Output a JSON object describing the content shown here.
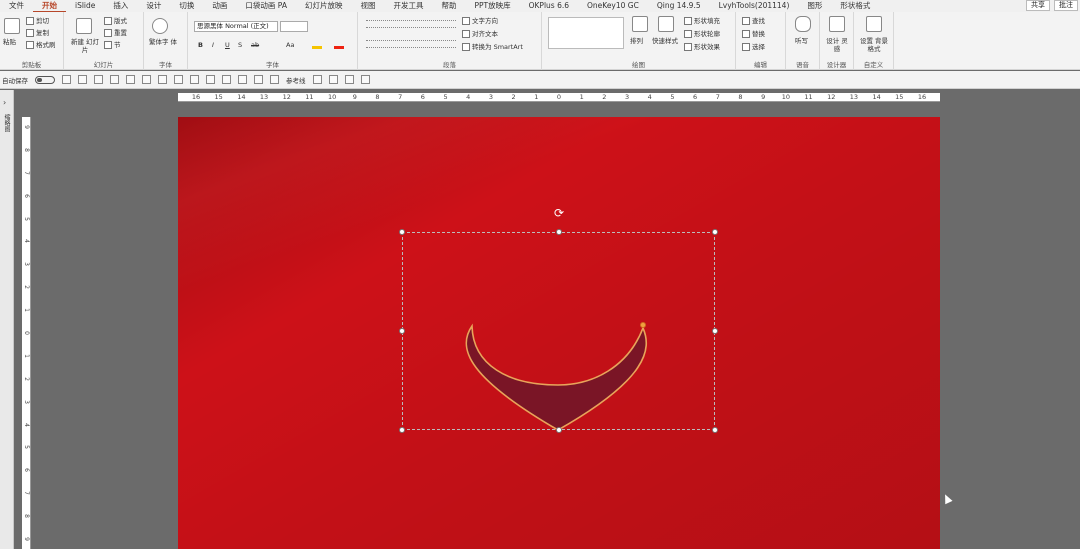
{
  "tabs": [
    "文件",
    "开始",
    "iSlide",
    "插入",
    "设计",
    "切换",
    "动画",
    "口袋动画 PA",
    "幻灯片放映",
    "视图",
    "开发工具",
    "帮助",
    "PPT放映库",
    "OKPlus 6.6",
    "OneKey10 GC",
    "Qing 14.9.5",
    "LvyhTools(201114)",
    "图形",
    "形状格式"
  ],
  "active_tab": "开始",
  "tabs_right": {
    "share": "共享",
    "comment": "批注"
  },
  "ribbon": {
    "clipboard": {
      "label": "剪贴板",
      "paste": "粘贴",
      "cut": "剪切",
      "copy": "复制",
      "format_painter": "格式刷"
    },
    "slides": {
      "label": "幻灯片",
      "new_slide": "新建 幻灯片",
      "layout": "版式",
      "reset": "重置",
      "section": "节"
    },
    "chinese": {
      "label": "字体",
      "name": "繁体字 体"
    },
    "font": {
      "label": "字体",
      "font_name": "思源黑体 Normal (正文)",
      "size": "",
      "bold": "B",
      "italic": "I",
      "underline": "U",
      "strike": "S",
      "spacing": "ab",
      "case": "Aa"
    },
    "paragraph": {
      "label": "段落",
      "text_direction": "文字方向",
      "align_text": "对齐文本",
      "smartart": "转换为 SmartArt"
    },
    "drawing": {
      "label": "绘图",
      "arrange": "排列",
      "quick_styles": "快速样式",
      "shape_fill": "形状填充",
      "shape_outline": "形状轮廓",
      "shape_effects": "形状效果"
    },
    "editing": {
      "label": "编辑",
      "find": "查找",
      "replace": "替换",
      "select": "选择"
    },
    "voice": {
      "label": "语音",
      "dictate": "听写"
    },
    "designer": {
      "label": "设计器",
      "design_ideas": "设计 灵感"
    },
    "custom": {
      "label": "自定义",
      "background": "设置 背景格式"
    }
  },
  "qat": {
    "autosave": "自动保存",
    "reference_line": "参考线"
  },
  "left_pane": {
    "label": "缩略图"
  },
  "hruler_ticks": [
    "16",
    "15",
    "14",
    "13",
    "12",
    "11",
    "10",
    "9",
    "8",
    "7",
    "6",
    "5",
    "4",
    "3",
    "2",
    "1",
    "0",
    "1",
    "2",
    "3",
    "4",
    "5",
    "6",
    "7",
    "8",
    "9",
    "10",
    "11",
    "12",
    "13",
    "14",
    "15",
    "16"
  ],
  "vruler_ticks": [
    "9",
    "8",
    "7",
    "6",
    "5",
    "4",
    "3",
    "2",
    "1",
    "0",
    "1",
    "2",
    "3",
    "4",
    "5",
    "6",
    "7",
    "8",
    "9"
  ],
  "colors": {
    "slide_bg": "#cd1118",
    "shape_fill": "#7a1526",
    "shape_outline": "#e8a45a",
    "accent": "#b7472a"
  },
  "icons": [
    "paste-icon",
    "cut-icon",
    "copy-icon",
    "format-painter-icon",
    "new-slide-icon",
    "bold-icon",
    "italic-icon",
    "underline-icon",
    "font-color-icon",
    "shape-gallery-icon",
    "find-icon",
    "microphone-icon",
    "designer-icon",
    "background-icon",
    "rotate-icon",
    "cursor-icon"
  ]
}
